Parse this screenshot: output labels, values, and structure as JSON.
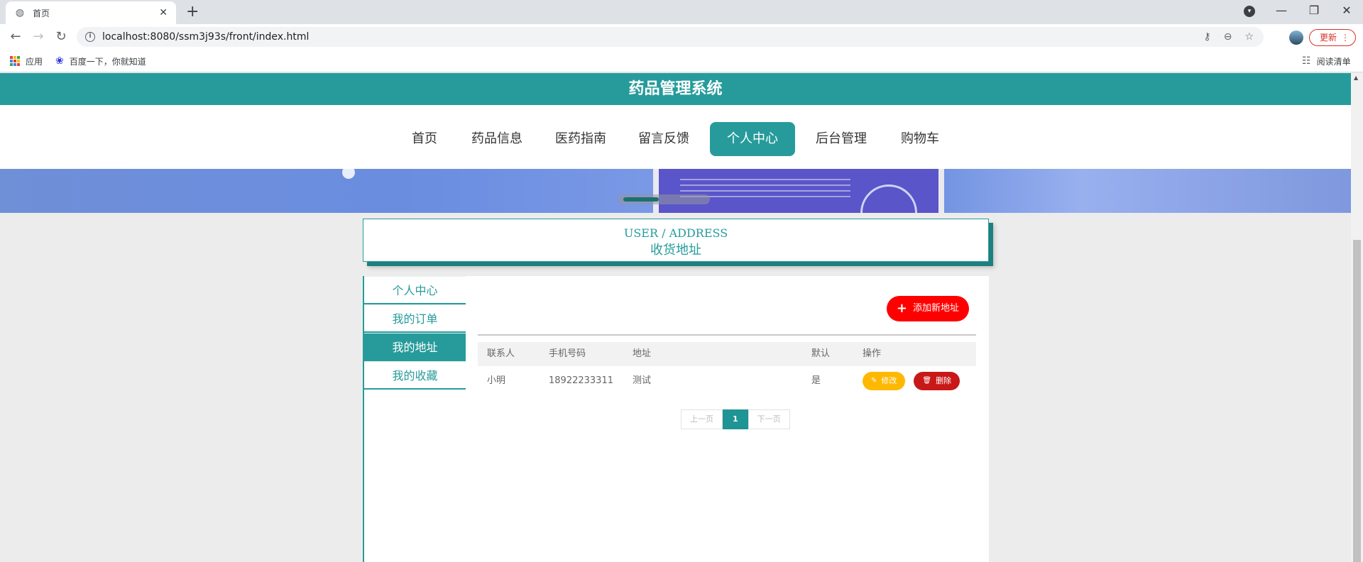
{
  "browser": {
    "tab_title": "首页",
    "url": "localhost:8080/ssm3j93s/front/index.html",
    "update_label": "更新",
    "bookmarks": [
      {
        "label": "应用"
      },
      {
        "label": "百度一下，你就知道"
      }
    ],
    "reading_list": "阅读清单"
  },
  "site": {
    "title": "药品管理系统"
  },
  "nav": {
    "items": [
      {
        "label": "首页"
      },
      {
        "label": "药品信息"
      },
      {
        "label": "医药指南"
      },
      {
        "label": "留言反馈"
      },
      {
        "label": "个人中心",
        "active": true
      },
      {
        "label": "后台管理"
      },
      {
        "label": "购物车"
      }
    ]
  },
  "section": {
    "title_en": "USER / ADDRESS",
    "title_cn": "收货地址"
  },
  "sidebar": {
    "items": [
      {
        "label": "个人中心"
      },
      {
        "label": "我的订单"
      },
      {
        "label": "我的地址",
        "active": true
      },
      {
        "label": "我的收藏"
      }
    ]
  },
  "address": {
    "add_label": "添加新地址",
    "columns": [
      "联系人",
      "手机号码",
      "地址",
      "默认",
      "操作"
    ],
    "rows": [
      {
        "name": "小明",
        "phone": "18922233311",
        "address": "测试",
        "default": "是"
      }
    ],
    "edit_label": "修改",
    "delete_label": "删除"
  },
  "pagination": {
    "prev": "上一页",
    "current": "1",
    "next": "下一页"
  },
  "colors": {
    "primary": "#279b9b",
    "add_button": "#ff0000",
    "edit_button": "#ffb800",
    "delete_button": "#c81818"
  }
}
